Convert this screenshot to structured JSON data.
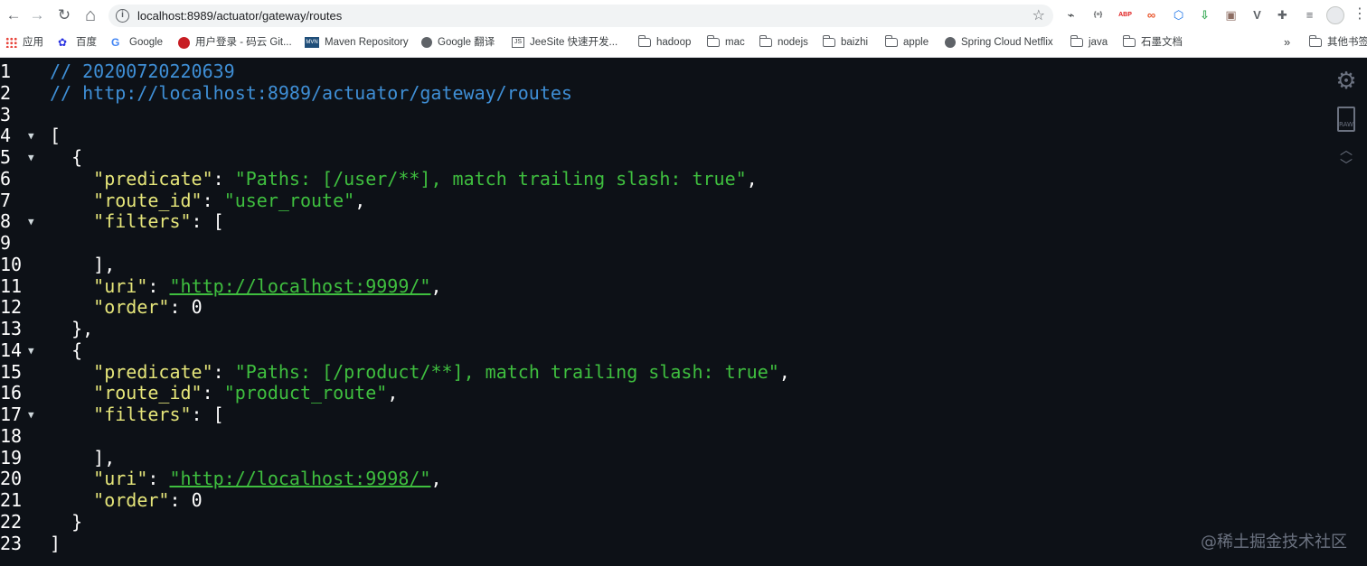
{
  "browser": {
    "url": "localhost:8989/actuator/gateway/routes",
    "nav": {
      "back": "←",
      "forward": "→",
      "reload": "↻",
      "home": "⌂"
    },
    "extensions": [
      {
        "name": "qrcode",
        "label": "⌁",
        "color": "#3c4043"
      },
      {
        "name": "json",
        "label": "{≡}",
        "color": "#3c4043"
      },
      {
        "name": "abp",
        "label": "ABP",
        "color": "#e02020"
      },
      {
        "name": "infinity",
        "label": "∞",
        "color": "#e8542a"
      },
      {
        "name": "cube",
        "label": "⬡",
        "color": "#1a73e8"
      },
      {
        "name": "pin",
        "label": "⇩",
        "color": "#34a853"
      },
      {
        "name": "image",
        "label": "▣",
        "color": "#8d6e63"
      },
      {
        "name": "vue",
        "label": "V",
        "color": "#5f6368"
      },
      {
        "name": "puzzle",
        "label": "✚",
        "color": "#5f6368"
      },
      {
        "name": "playlist",
        "label": "≡",
        "color": "#5f6368"
      }
    ],
    "bookmarks": [
      {
        "label": "应用",
        "icon": "apps-grid-icon"
      },
      {
        "label": "百度",
        "icon": "baidu-icon"
      },
      {
        "label": "Google",
        "icon": "google-icon"
      },
      {
        "label": "用户登录 - 码云 Git...",
        "icon": "gitee-icon"
      },
      {
        "label": "Maven Repository",
        "icon": "maven-icon"
      },
      {
        "label": "Google 翻译",
        "icon": "globe-icon"
      },
      {
        "label": "JeeSite 快速开发...",
        "icon": "jeesite-icon"
      },
      {
        "label": "hadoop",
        "icon": "folder-icon"
      },
      {
        "label": "mac",
        "icon": "folder-icon"
      },
      {
        "label": "nodejs",
        "icon": "folder-icon"
      },
      {
        "label": "baizhi",
        "icon": "folder-icon"
      },
      {
        "label": "apple",
        "icon": "folder-icon"
      },
      {
        "label": "Spring Cloud Netflix",
        "icon": "globe-icon"
      },
      {
        "label": "java",
        "icon": "folder-icon"
      },
      {
        "label": "石墨文档",
        "icon": "folder-icon"
      }
    ],
    "more_bookmarks": "»",
    "other_bookmarks": "其他书签"
  },
  "viewer": {
    "raw_label": "RAW",
    "watermark": "@稀土掘金技术社区",
    "lines": [
      {
        "n": "1",
        "fold": "",
        "parts": [
          {
            "t": "// 20200720220639",
            "c": "comment"
          }
        ]
      },
      {
        "n": "2",
        "fold": "",
        "parts": [
          {
            "t": "// http://localhost:8989/actuator/gateway/routes",
            "c": "comment"
          }
        ]
      },
      {
        "n": "3",
        "fold": "",
        "parts": []
      },
      {
        "n": "4",
        "fold": "▼",
        "parts": [
          {
            "t": "[",
            "c": "punc"
          }
        ]
      },
      {
        "n": "5",
        "fold": "▼",
        "parts": [
          {
            "t": "  {",
            "c": "punc"
          }
        ]
      },
      {
        "n": "6",
        "fold": "",
        "parts": [
          {
            "t": "    ",
            "c": "punc"
          },
          {
            "t": "\"predicate\"",
            "c": "key"
          },
          {
            "t": ": ",
            "c": "punc"
          },
          {
            "t": "\"Paths: [/user/**], match trailing slash: true\"",
            "c": "str"
          },
          {
            "t": ",",
            "c": "punc"
          }
        ]
      },
      {
        "n": "7",
        "fold": "",
        "parts": [
          {
            "t": "    ",
            "c": "punc"
          },
          {
            "t": "\"route_id\"",
            "c": "key"
          },
          {
            "t": ": ",
            "c": "punc"
          },
          {
            "t": "\"user_route\"",
            "c": "str"
          },
          {
            "t": ",",
            "c": "punc"
          }
        ]
      },
      {
        "n": "8",
        "fold": "▼",
        "parts": [
          {
            "t": "    ",
            "c": "punc"
          },
          {
            "t": "\"filters\"",
            "c": "key"
          },
          {
            "t": ": [",
            "c": "punc"
          }
        ]
      },
      {
        "n": "9",
        "fold": "",
        "parts": []
      },
      {
        "n": "10",
        "fold": "",
        "parts": [
          {
            "t": "    ],",
            "c": "punc"
          }
        ]
      },
      {
        "n": "11",
        "fold": "",
        "parts": [
          {
            "t": "    ",
            "c": "punc"
          },
          {
            "t": "\"uri\"",
            "c": "key"
          },
          {
            "t": ": ",
            "c": "punc"
          },
          {
            "t": "\"http://localhost:9999/\"",
            "c": "link"
          },
          {
            "t": ",",
            "c": "punc"
          }
        ]
      },
      {
        "n": "12",
        "fold": "",
        "parts": [
          {
            "t": "    ",
            "c": "punc"
          },
          {
            "t": "\"order\"",
            "c": "key"
          },
          {
            "t": ": ",
            "c": "punc"
          },
          {
            "t": "0",
            "c": "num"
          }
        ]
      },
      {
        "n": "13",
        "fold": "",
        "parts": [
          {
            "t": "  },",
            "c": "punc"
          }
        ]
      },
      {
        "n": "14",
        "fold": "▼",
        "parts": [
          {
            "t": "  {",
            "c": "punc"
          }
        ]
      },
      {
        "n": "15",
        "fold": "",
        "parts": [
          {
            "t": "    ",
            "c": "punc"
          },
          {
            "t": "\"predicate\"",
            "c": "key"
          },
          {
            "t": ": ",
            "c": "punc"
          },
          {
            "t": "\"Paths: [/product/**], match trailing slash: true\"",
            "c": "str"
          },
          {
            "t": ",",
            "c": "punc"
          }
        ]
      },
      {
        "n": "16",
        "fold": "",
        "parts": [
          {
            "t": "    ",
            "c": "punc"
          },
          {
            "t": "\"route_id\"",
            "c": "key"
          },
          {
            "t": ": ",
            "c": "punc"
          },
          {
            "t": "\"product_route\"",
            "c": "str"
          },
          {
            "t": ",",
            "c": "punc"
          }
        ]
      },
      {
        "n": "17",
        "fold": "▼",
        "parts": [
          {
            "t": "    ",
            "c": "punc"
          },
          {
            "t": "\"filters\"",
            "c": "key"
          },
          {
            "t": ": [",
            "c": "punc"
          }
        ]
      },
      {
        "n": "18",
        "fold": "",
        "parts": []
      },
      {
        "n": "19",
        "fold": "",
        "parts": [
          {
            "t": "    ],",
            "c": "punc"
          }
        ]
      },
      {
        "n": "20",
        "fold": "",
        "parts": [
          {
            "t": "    ",
            "c": "punc"
          },
          {
            "t": "\"uri\"",
            "c": "key"
          },
          {
            "t": ": ",
            "c": "punc"
          },
          {
            "t": "\"http://localhost:9998/\"",
            "c": "link"
          },
          {
            "t": ",",
            "c": "punc"
          }
        ]
      },
      {
        "n": "21",
        "fold": "",
        "parts": [
          {
            "t": "    ",
            "c": "punc"
          },
          {
            "t": "\"order\"",
            "c": "key"
          },
          {
            "t": ": ",
            "c": "punc"
          },
          {
            "t": "0",
            "c": "num"
          }
        ]
      },
      {
        "n": "22",
        "fold": "",
        "parts": [
          {
            "t": "  }",
            "c": "punc"
          }
        ]
      },
      {
        "n": "23",
        "fold": "",
        "parts": [
          {
            "t": "]",
            "c": "punc"
          }
        ]
      }
    ]
  }
}
